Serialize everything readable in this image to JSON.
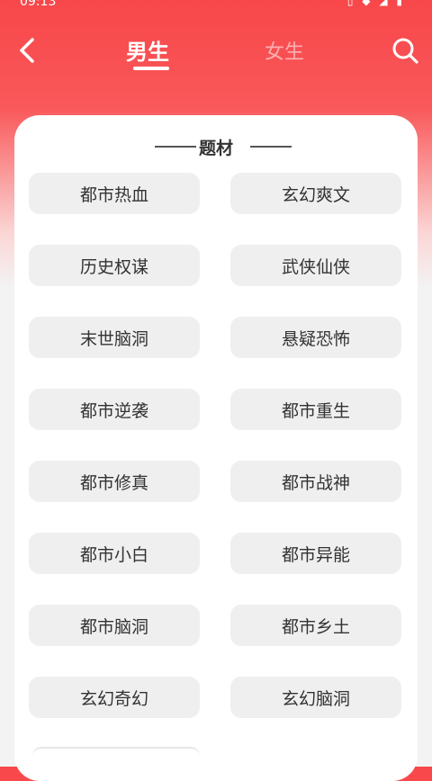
{
  "status_bar": {
    "time": "09:13",
    "icons": "▯ ◆ ◢ ▮"
  },
  "nav": {
    "tabs": [
      {
        "label": "男生",
        "active": true
      },
      {
        "label": "女生",
        "active": false
      }
    ]
  },
  "section": {
    "title": "题材"
  },
  "genres": [
    "都市热血",
    "玄幻爽文",
    "历史权谋",
    "武侠仙侠",
    "末世脑洞",
    "悬疑恐怖",
    "都市逆袭",
    "都市重生",
    "都市修真",
    "都市战神",
    "都市小白",
    "都市异能",
    "都市脑洞",
    "都市乡土",
    "玄幻奇幻",
    "玄幻脑洞"
  ],
  "colors": {
    "accent": "#f8474a",
    "chip_bg": "#efefef",
    "text": "#333333"
  },
  "icons": {
    "back": "back-arrow-icon",
    "search": "search-icon"
  }
}
